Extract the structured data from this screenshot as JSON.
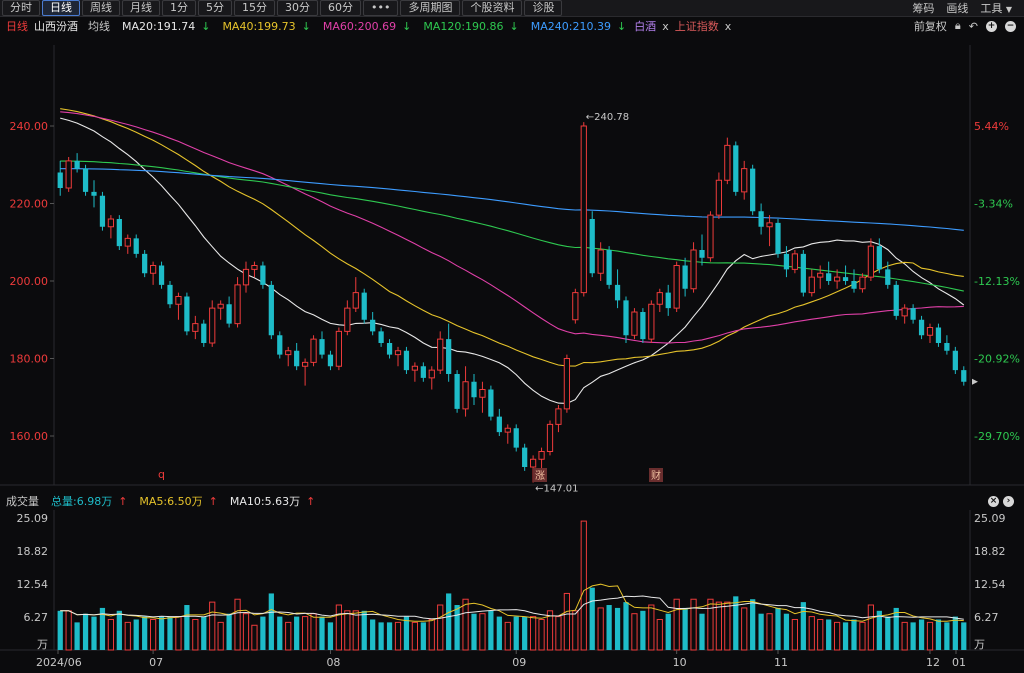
{
  "toolbar": {
    "tabs": [
      "分时",
      "日线",
      "周线",
      "月线",
      "1分",
      "5分",
      "15分",
      "30分",
      "60分",
      "•••",
      "多周期图",
      "个股资料",
      "诊股"
    ],
    "active_tab": "日线",
    "right": [
      "筹码",
      "画线",
      "工具"
    ],
    "right_dropdown_icon": "caret-down-icon"
  },
  "ma_bar": {
    "period": "日线",
    "name": "山西汾酒",
    "mode": "均线",
    "ma": [
      {
        "label": "MA20:191.74",
        "color": "#e8e8e8",
        "arrow": "down"
      },
      {
        "label": "MA40:199.73",
        "color": "#e6c32b",
        "arrow": "down"
      },
      {
        "label": "MA60:200.69",
        "color": "#e040a8",
        "arrow": "down"
      },
      {
        "label": "MA120:190.86",
        "color": "#2ec850",
        "arrow": "down"
      },
      {
        "label": "MA240:210.39",
        "color": "#3d9cff",
        "arrow": "down"
      }
    ],
    "compare": [
      {
        "label": "白酒",
        "color": "#b07ee8"
      },
      {
        "label": "上证指数",
        "color": "#d85a5a"
      }
    ],
    "remove_glyph": "x",
    "adjust": "前复权"
  },
  "colors": {
    "up": "#ee3b3b",
    "down": "#1ebcc8",
    "axis_left": "#ee3b3b",
    "pct_up": "#ee3b3b",
    "pct_down": "#2ec850"
  },
  "price_axis": {
    "labels": [
      "240.00",
      "220.00",
      "200.00",
      "180.00",
      "160.00"
    ],
    "pct_labels": [
      "5.44%",
      "-3.34%",
      "-12.13%",
      "-20.92%",
      "-29.70%"
    ],
    "high_note": "←240.78",
    "low_note": "←147.01"
  },
  "markers": [
    {
      "text": "q",
      "kind": "text"
    },
    {
      "text": "涨",
      "kind": "box"
    },
    {
      "text": "财",
      "kind": "box"
    }
  ],
  "volume": {
    "title": "成交量",
    "total": "总量:6.98万",
    "ma5": "MA5:6.50万",
    "ma10": "MA10:5.63万",
    "axis_labels": [
      "25.09",
      "18.82",
      "12.54",
      "6.27",
      "万"
    ]
  },
  "date_axis": [
    "2024/06",
    "07",
    "08",
    "09",
    "10",
    "11",
    "12",
    "01"
  ],
  "chart_data": {
    "type": "candlestick",
    "ylim": [
      140,
      250
    ],
    "daily_ohlc": [
      [
        228,
        231,
        222,
        224
      ],
      [
        224,
        232,
        223,
        231
      ],
      [
        231,
        233,
        228,
        229
      ],
      [
        229,
        230,
        222,
        223
      ],
      [
        223,
        226,
        219,
        222
      ],
      [
        222,
        223,
        213,
        214
      ],
      [
        214,
        217,
        211,
        216
      ],
      [
        216,
        217,
        208,
        209
      ],
      [
        209,
        212,
        207,
        211
      ],
      [
        211,
        212,
        206,
        207
      ],
      [
        207,
        208,
        201,
        202
      ],
      [
        202,
        205,
        199,
        204
      ],
      [
        204,
        205,
        198,
        199
      ],
      [
        199,
        200,
        193,
        194
      ],
      [
        194,
        197,
        190,
        196
      ],
      [
        196,
        197,
        186,
        187
      ],
      [
        187,
        191,
        185,
        189
      ],
      [
        189,
        190,
        183,
        184
      ],
      [
        184,
        195,
        183,
        193
      ],
      [
        193,
        195,
        190,
        194
      ],
      [
        194,
        196,
        188,
        189
      ],
      [
        189,
        201,
        188,
        199
      ],
      [
        199,
        205,
        197,
        203
      ],
      [
        203,
        205,
        201,
        204
      ],
      [
        204,
        205,
        198,
        199
      ],
      [
        199,
        200,
        185,
        186
      ],
      [
        186,
        187,
        180,
        181
      ],
      [
        181,
        183,
        178,
        182
      ],
      [
        182,
        184,
        177,
        178
      ],
      [
        178,
        180,
        173,
        179
      ],
      [
        179,
        186,
        178,
        185
      ],
      [
        185,
        187,
        180,
        181
      ],
      [
        181,
        182,
        177,
        178
      ],
      [
        178,
        188,
        177,
        187
      ],
      [
        187,
        195,
        186,
        193
      ],
      [
        193,
        201,
        192,
        197
      ],
      [
        197,
        198,
        189,
        190
      ],
      [
        190,
        192,
        186,
        187
      ],
      [
        187,
        188,
        183,
        184
      ],
      [
        184,
        185,
        180,
        181
      ],
      [
        181,
        183,
        178,
        182
      ],
      [
        182,
        183,
        176,
        177
      ],
      [
        177,
        179,
        174,
        178
      ],
      [
        178,
        179,
        174,
        175
      ],
      [
        175,
        178,
        172,
        177
      ],
      [
        177,
        187,
        176,
        185
      ],
      [
        185,
        189,
        174,
        176
      ],
      [
        176,
        177,
        166,
        167
      ],
      [
        167,
        178,
        165,
        174
      ],
      [
        174,
        176,
        168,
        170
      ],
      [
        170,
        174,
        166,
        172
      ],
      [
        172,
        173,
        164,
        165
      ],
      [
        165,
        167,
        160,
        161
      ],
      [
        161,
        163,
        158,
        162
      ],
      [
        162,
        163,
        156,
        157
      ],
      [
        157,
        158,
        151,
        152
      ],
      [
        152,
        155,
        148,
        154
      ],
      [
        154,
        157,
        151,
        156
      ],
      [
        156,
        164,
        155,
        163
      ],
      [
        163,
        168,
        161,
        167
      ],
      [
        167,
        181,
        166,
        180
      ],
      [
        190,
        198,
        189,
        197
      ],
      [
        197,
        241,
        196,
        240
      ],
      [
        216,
        218,
        201,
        202
      ],
      [
        202,
        210,
        200,
        208
      ],
      [
        208,
        209,
        198,
        199
      ],
      [
        199,
        203,
        193,
        195
      ],
      [
        195,
        196,
        184,
        186
      ],
      [
        186,
        193,
        185,
        192
      ],
      [
        192,
        193,
        184,
        185
      ],
      [
        185,
        195,
        184,
        194
      ],
      [
        194,
        198,
        192,
        197
      ],
      [
        197,
        199,
        191,
        193
      ],
      [
        193,
        205,
        192,
        204
      ],
      [
        204,
        206,
        196,
        198
      ],
      [
        198,
        210,
        197,
        208
      ],
      [
        208,
        212,
        204,
        206
      ],
      [
        206,
        218,
        205,
        217
      ],
      [
        217,
        228,
        216,
        226
      ],
      [
        226,
        237,
        225,
        235
      ],
      [
        235,
        236,
        222,
        223
      ],
      [
        223,
        231,
        221,
        229
      ],
      [
        229,
        230,
        217,
        218
      ],
      [
        218,
        220,
        212,
        214
      ],
      [
        214,
        217,
        209,
        215
      ],
      [
        215,
        216,
        206,
        207
      ],
      [
        207,
        209,
        201,
        203
      ],
      [
        203,
        208,
        202,
        207
      ],
      [
        207,
        208,
        196,
        197
      ],
      [
        197,
        203,
        196,
        201
      ],
      [
        201,
        204,
        198,
        202
      ],
      [
        202,
        205,
        199,
        200
      ],
      [
        200,
        203,
        198,
        201
      ],
      [
        201,
        204,
        199,
        200
      ],
      [
        200,
        203,
        197,
        198
      ],
      [
        198,
        202,
        197,
        201
      ],
      [
        201,
        211,
        200,
        209
      ],
      [
        209,
        211,
        202,
        203
      ],
      [
        203,
        205,
        198,
        199
      ],
      [
        199,
        200,
        190,
        191
      ],
      [
        191,
        194,
        189,
        193
      ],
      [
        193,
        194,
        189,
        190
      ],
      [
        190,
        191,
        185,
        186
      ],
      [
        186,
        189,
        184,
        188
      ],
      [
        188,
        189,
        183,
        184
      ],
      [
        184,
        186,
        181,
        182
      ],
      [
        182,
        183,
        176,
        177
      ],
      [
        177,
        178,
        173,
        174
      ]
    ]
  }
}
